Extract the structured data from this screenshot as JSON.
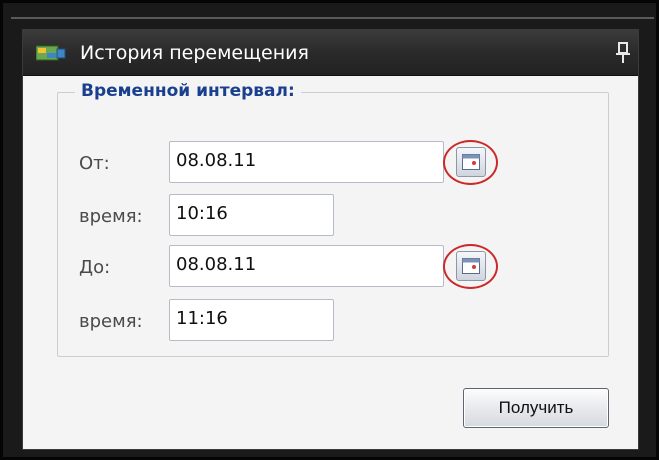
{
  "window": {
    "title": "История перемещения"
  },
  "time_interval": {
    "legend": "Временной интервал:",
    "from": {
      "label": "От:",
      "date": "08.08.11",
      "time_label": "время:",
      "time": "10:16"
    },
    "to": {
      "label": "До:",
      "date": "08.08.11",
      "time_label": "время:",
      "time": "11:16"
    }
  },
  "actions": {
    "get_label": "Получить"
  },
  "icons": {
    "title": "map-icon",
    "pin": "pin-icon",
    "calendar": "calendar-icon"
  },
  "colors": {
    "legend": "#1a3f8f",
    "highlight": "#cc2a2a",
    "titlebar": "#2e2e2e"
  }
}
